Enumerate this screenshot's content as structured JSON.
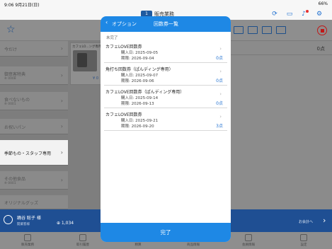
{
  "status_bar": {
    "time": "9:06",
    "date": "9月21日(日)",
    "battery": "66%"
  },
  "top_bar": {
    "register_badge": "1",
    "title": "販売業務"
  },
  "toolbar": {
    "icons": [
      "star-icon",
      "ticket-icon",
      "store-icon",
      "delivery-icon",
      "card-icon",
      "stop-icon"
    ]
  },
  "sidebar": {
    "items": [
      {
        "label": "今だけ",
        "sub": ""
      },
      {
        "label": "御意客特典",
        "sub": "※ 0008"
      },
      {
        "label": "食べないもの",
        "sub": "※ 0001"
      },
      {
        "label": "お祝いパン",
        "sub": ""
      },
      {
        "label": "季節もの・スタッフ専用",
        "sub": ""
      },
      {
        "label": "その他食品",
        "sub": "※ 0001"
      },
      {
        "label": "オリジナルグッズ",
        "sub": ""
      }
    ]
  },
  "product": {
    "name": "カフェLO...ング専用)",
    "price": "¥ 0"
  },
  "order": {
    "total": "0点"
  },
  "customer": {
    "name": "踊谷 聡子 様",
    "rank": "開業客様",
    "points": "⊕ 1,034",
    "checkout_label": "お会計へ"
  },
  "tabs": [
    "販売業務",
    "取引履歴",
    "精算",
    "商品情報",
    "会員情報",
    "設定"
  ],
  "modal": {
    "back_label": "オプション",
    "title": "回数券一覧",
    "section": "未完了",
    "tickets": [
      {
        "name": "カフェLOVE回数券",
        "purchase": "購入日: 2025-09-05",
        "expiry": "期限: 2026-09-04",
        "points": "0点"
      },
      {
        "name": "角打ち回数券（ぱんディング専用）",
        "purchase": "購入日: 2025-09-07",
        "expiry": "期限: 2026-09-06",
        "points": "0点"
      },
      {
        "name": "カフェLOVE回数券（ぱんディング専用）",
        "purchase": "購入日: 2025-09-14",
        "expiry": "期限: 2026-09-13",
        "points": "0点"
      },
      {
        "name": "カフェLOVE回数券",
        "purchase": "購入日: 2025-09-21",
        "expiry": "期限: 2026-09-20",
        "points": "3点"
      }
    ],
    "done_label": "完了"
  }
}
